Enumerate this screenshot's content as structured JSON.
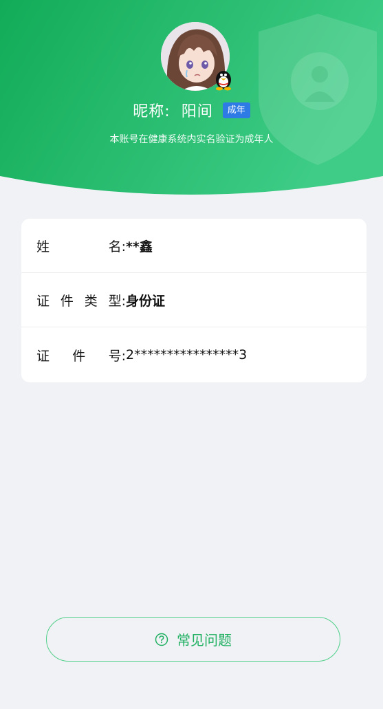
{
  "header": {
    "nickname_label": "昵称:",
    "nickname": "阳间",
    "age_badge": "成年",
    "verify_text": "本账号在健康系统内实名验证为成年人",
    "colors": {
      "gradient_start": "#17b25e",
      "gradient_end": "#3fce86",
      "badge": "#2f7be5"
    }
  },
  "identity": {
    "rows": [
      {
        "label": [
          "姓",
          "名:"
        ],
        "value": "**鑫"
      },
      {
        "label": [
          "证",
          "件",
          "类",
          "型:"
        ],
        "value": "身份证"
      },
      {
        "label": [
          "证",
          "件",
          "号:"
        ],
        "value": "2****************3"
      }
    ]
  },
  "footer": {
    "faq_label": "常见问题",
    "faq_icon": "question-circle-icon",
    "accent": "#20b061"
  }
}
